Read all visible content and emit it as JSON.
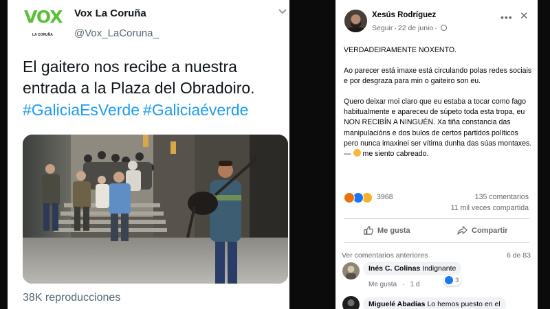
{
  "twitter": {
    "logo": {
      "wordmark": "VOX",
      "subtitle": "",
      "region": "LA CORUÑA",
      "color": "#5ac035"
    },
    "display_name": "Vox La Coruña",
    "handle": "@Vox_LaCoruna_",
    "menu_icon": "chevron-down-icon",
    "tweet_text": "El gaitero nos recibe a nuestra entrada a la Plaza del Obradoiro.",
    "hashtags": [
      "#GaliciaEsVerde",
      "#Galiciaéverde"
    ],
    "hashtag_color": "#1d9bf0",
    "views": "38K reproducciones"
  },
  "facebook": {
    "author": "Xesús Rodríguez",
    "follow_label": "Seguir",
    "date": "22 de junio",
    "privacy_icon": "globe-icon",
    "more_icon": "more-options-icon",
    "close_icon": "close-icon",
    "post": {
      "p1": "VERDADEIRAMENTE NOXENTO.",
      "p2": "Ao parecer está imaxe está circulando polas redes sociais e por desgraza para min o gaiteiro son eu.",
      "p3a": "Quero deixar moi claro que eu estaba a tocar como fago habitualmente e apareceu de súpeto toda esta tropa, eu NON RECIBÍN A NINGUÉN. Xa tiña constancia das manipulacións e dos bulos de certos partidos políticos pero nunca imaxinei ser vítima dunha das súas montaxes. —",
      "p3b": "me siento cabreado."
    },
    "reactions_count": "3968",
    "comments_count": "135 comentarios",
    "shares_count": "11 mil veces compartida",
    "like_label": "Me gusta",
    "share_label": "Compartir",
    "previous_comments": "Ver comentarios anteriores",
    "pager": "6 de 83",
    "comments": [
      {
        "name": "Inés C. Colinas",
        "text": "Indignante",
        "like_action": "Me gusta",
        "time": "1 d",
        "likes": "3"
      },
      {
        "name": "Miguelé Abadías",
        "text": "Lo hemos puesto en el"
      }
    ],
    "reaction_colors": {
      "angry": "#e9710f",
      "like": "#1877f2",
      "wow": "#f7b125"
    },
    "accent": "#1877f2"
  }
}
